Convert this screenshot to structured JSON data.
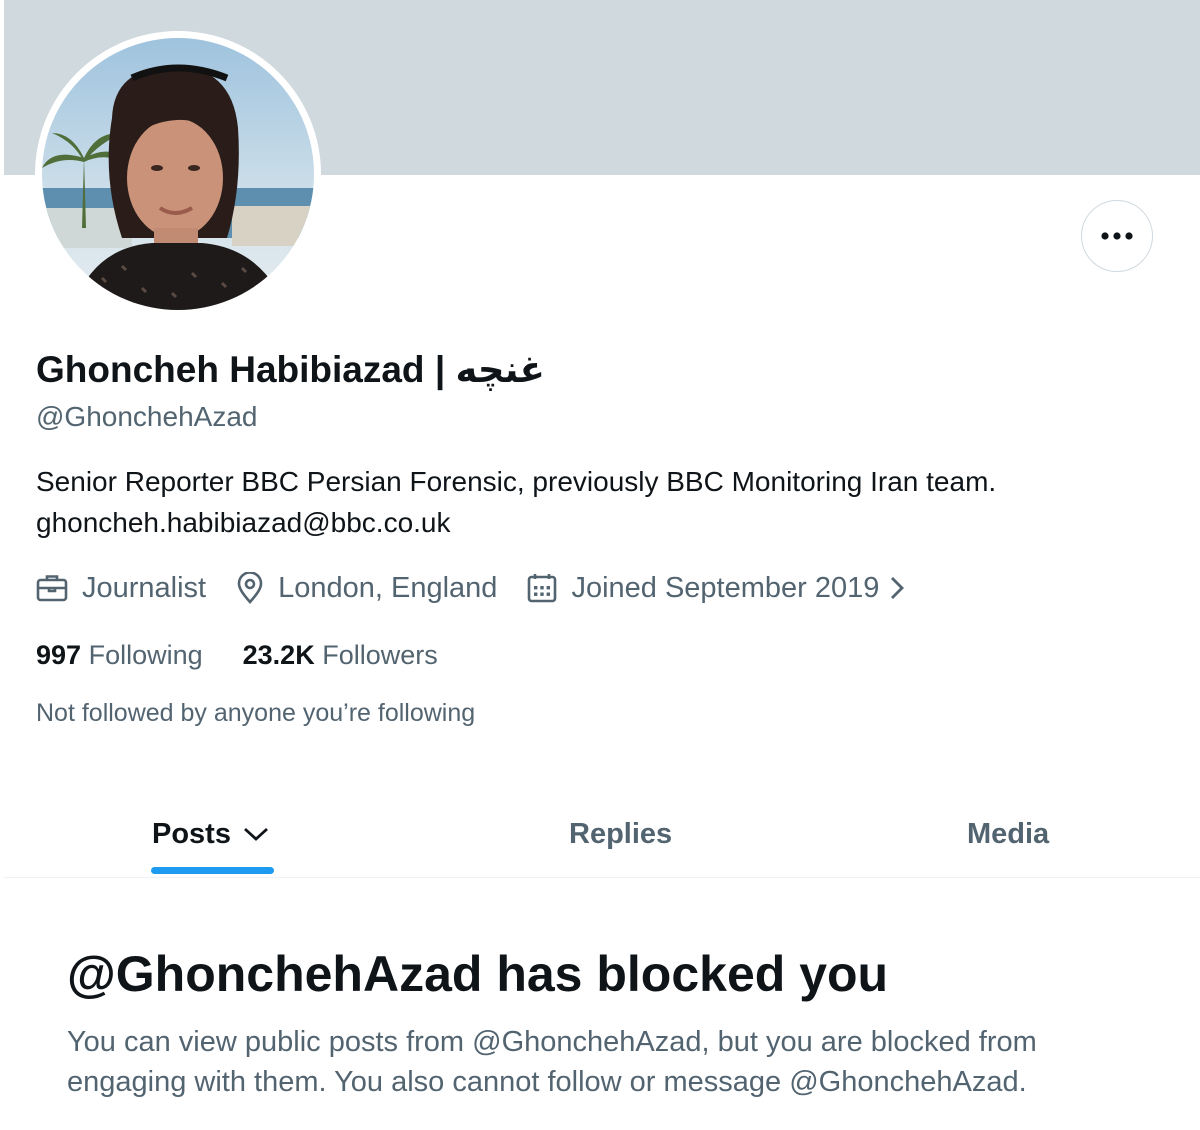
{
  "profile": {
    "display_name": "Ghoncheh Habibiazad | غنچه",
    "handle": "@GhonchehAzad",
    "bio_line1": "Senior Reporter BBC Persian Forensic, previously BBC Monitoring Iran team.",
    "bio_line2": "ghoncheh.habibiazad@bbc.co.uk",
    "profession": "Journalist",
    "location": "London, England",
    "joined": "Joined September 2019",
    "following_count": "997",
    "following_label": "Following",
    "followers_count": "23.2K",
    "followers_label": "Followers",
    "followed_by": "Not followed by anyone you’re following"
  },
  "tabs": {
    "posts": "Posts",
    "replies": "Replies",
    "media": "Media"
  },
  "blocked": {
    "title": "@GhonchehAzad has blocked you",
    "message_line1": "You can view public posts from @GhonchehAzad, but you are blocked from",
    "message_line2": "engaging with them. You also cannot follow or message @GhonchehAzad."
  },
  "icons": {
    "more": "more-horizontal-icon",
    "profession": "briefcase-icon",
    "location": "location-pin-icon",
    "joined": "calendar-icon",
    "joined_chevron": "chevron-right-icon",
    "posts_dropdown": "chevron-down-icon"
  },
  "colors": {
    "banner": "#cfd9de",
    "accent": "#1d9bf0",
    "primary_text": "#0f1419",
    "secondary_text": "#536471"
  }
}
